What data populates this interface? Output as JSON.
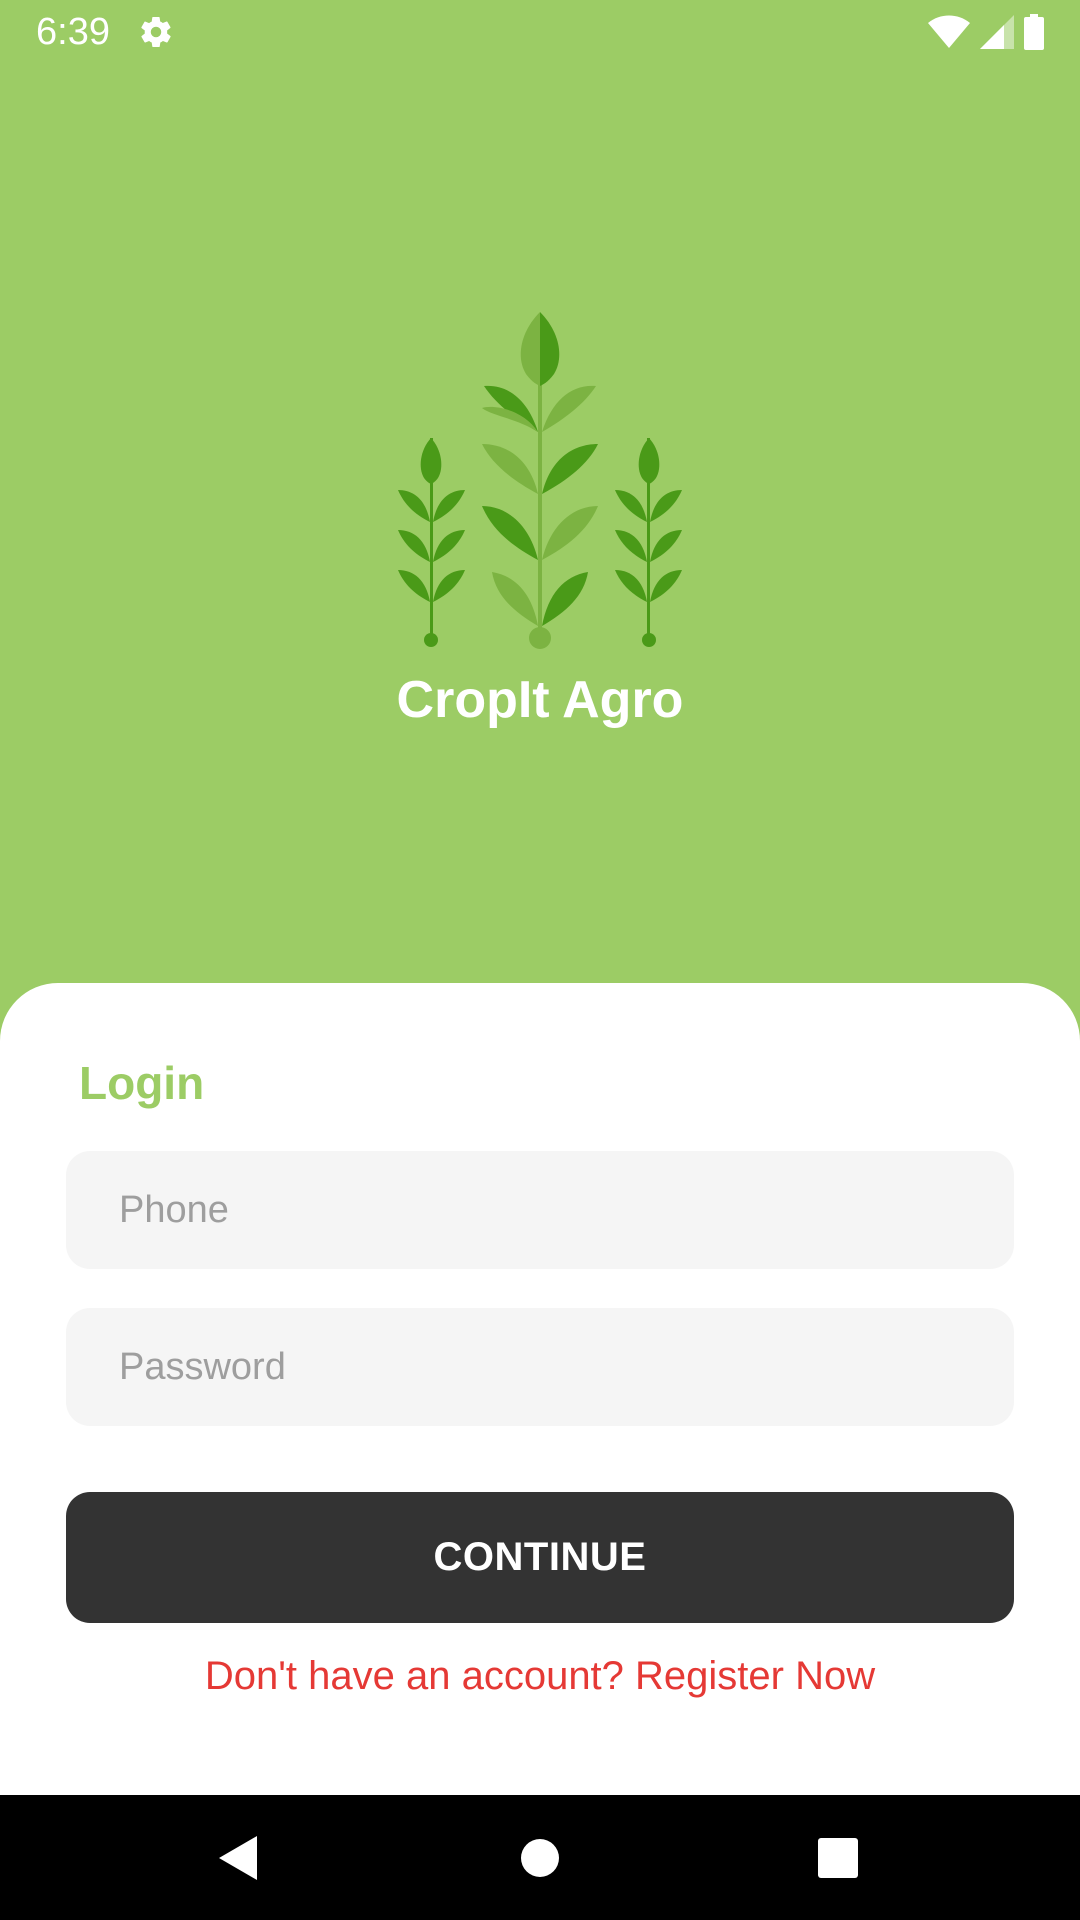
{
  "status_bar": {
    "time": "6:39",
    "icons": [
      "gear-icon",
      "wifi-icon",
      "signal-icon",
      "battery-icon"
    ]
  },
  "brand": {
    "name": "CropIt Agro",
    "logo": "wheat-plants-icon"
  },
  "login": {
    "title": "Login",
    "phone_placeholder": "Phone",
    "password_placeholder": "Password",
    "continue_label": "CONTINUE",
    "register_text": "Don't have an account? Register Now"
  },
  "nav_bar": {
    "buttons": [
      "back-icon",
      "home-icon",
      "recents-icon"
    ]
  },
  "colors": {
    "primary_green": "#9ccc65",
    "dark_button": "#333333",
    "register_red": "#e53935",
    "field_bg": "#f5f5f5",
    "leaf_dark": "#4a9a18",
    "leaf_light": "#7cb342"
  }
}
